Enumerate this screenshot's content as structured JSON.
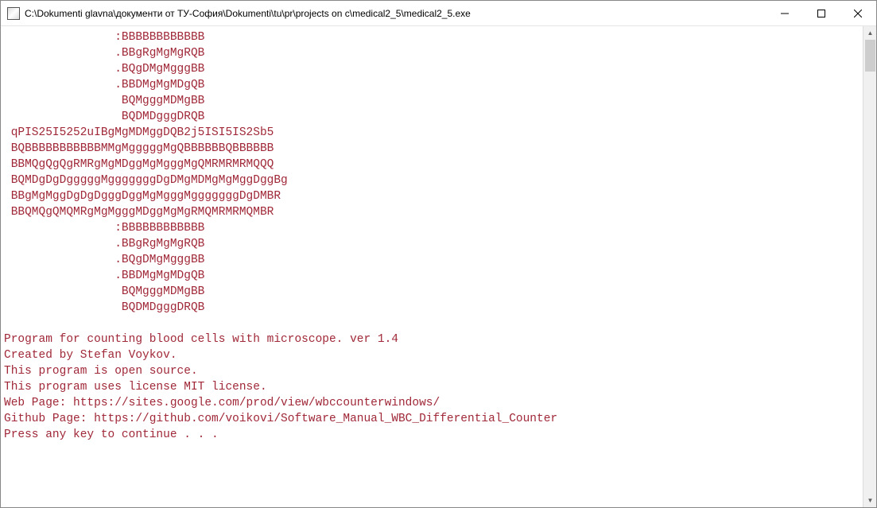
{
  "window": {
    "title": "C:\\Dokumenti glavna\\документи от ТУ-София\\Dokumenti\\tu\\pr\\projects on c\\medical2_5\\medical2_5.exe"
  },
  "console": {
    "ascii_art": [
      "                :BBBBBBBBBBBB",
      "                .BBgRgMgMgRQB",
      "                .BQgDMgMgggBB",
      "                .BBDMgMgMDgQB",
      "                 BQMgggMDMgBB",
      "                 BQDMDgggDRQB",
      " qPIS25I5252uIBgMgMDMggDQB2j5ISI5IS2Sb5",
      " BQBBBBBBBBBBBMMgMgggggMgQBBBBBBQBBBBBB",
      " BBMQgQgQgRMRgMgMDggMgMgggMgQMRMRMRMQQQ",
      " BQMDgDgDgggggMgggggggDgDMgMDMgMgMggDggBg",
      " BBgMgMggDgDgDgggDggMgMgggMgggggggDgDMBR",
      " BBQMQgQMQMRgMgMgggMDggMgMgRMQMRMRMQMBR",
      "                :BBBBBBBBBBBB",
      "                .BBgRgMgMgRQB",
      "                .BQgDMgMgggBB",
      "                .BBDMgMgMDgQB",
      "                 BQMgggMDMgBB",
      "                 BQDMDgggDRQB"
    ],
    "info_lines": [
      "Program for counting blood cells with microscope. ver 1.4",
      "Created by Stefan Voykov.",
      "This program is open source.",
      "This program uses license MIT license.",
      "Web Page: https://sites.google.com/prod/view/wbccounterwindows/",
      "Github Page: https://github.com/voikovi/Software_Manual_WBC_Differential_Counter",
      "Press any key to continue . . ."
    ]
  }
}
